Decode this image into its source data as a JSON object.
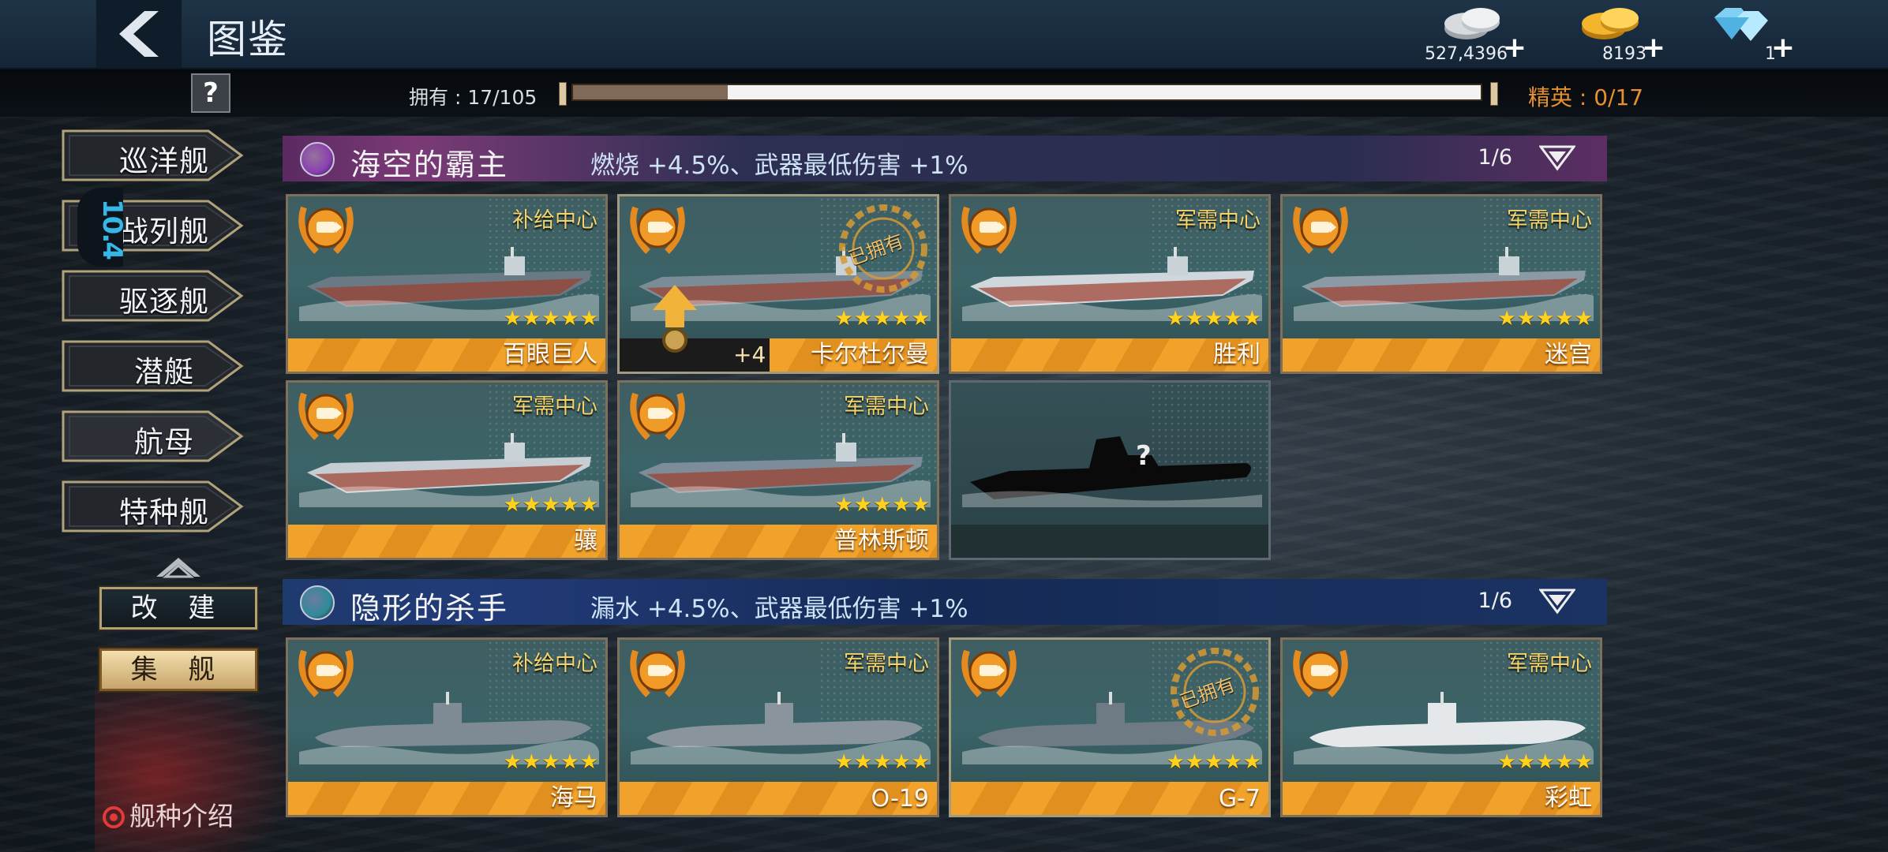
{
  "header": {
    "title": "图鉴",
    "help_label": "?",
    "currencies": [
      {
        "icon": "silver-coins-icon",
        "value": "527,4396",
        "plus": "+"
      },
      {
        "icon": "gold-coins-icon",
        "value": "8193",
        "plus": "+"
      },
      {
        "icon": "diamond-icon",
        "value": "1",
        "plus": "+"
      }
    ],
    "owned_text": "拥有 : 17/105",
    "owned_progress": 0.17,
    "elite_text": "精英 : 0/17"
  },
  "sidebar": {
    "tabs": [
      {
        "label": "巡洋舰",
        "active": false
      },
      {
        "label": "战列舰",
        "active": false
      },
      {
        "label": "驱逐舰",
        "active": false
      },
      {
        "label": "潜艇",
        "active": false
      },
      {
        "label": "航母",
        "active": true
      },
      {
        "label": "特种舰",
        "active": false
      }
    ],
    "badge_text": "10.4",
    "rebuild_label": "改 建",
    "fleet_label": "集 舰",
    "intro_label": "舰种介绍"
  },
  "sections": [
    {
      "title": "海空的霸主",
      "bonus": "燃烧 +4.5%、武器最低伤害 +1%",
      "page": "1/6",
      "emblem_color": "#8a3fb0",
      "cards": [
        {
          "name": "百眼巨人",
          "source": "补给中心",
          "stars": "★★★★★",
          "owned": false
        },
        {
          "name": "卡尔杜尔曼",
          "source": "",
          "stars": "★★★★★",
          "owned": true,
          "stamp": "已拥有",
          "upgrade": "+4"
        },
        {
          "name": "胜利",
          "source": "军需中心",
          "stars": "★★★★★",
          "owned": false
        },
        {
          "name": "迷宫",
          "source": "军需中心",
          "stars": "★★★★★",
          "owned": false
        },
        {
          "name": "骧",
          "source": "军需中心",
          "stars": "★★★★★",
          "owned": false
        },
        {
          "name": "普林斯顿",
          "source": "军需中心",
          "stars": "★★★★★",
          "owned": false
        },
        {
          "name": "",
          "source": "",
          "stars": "",
          "owned": false,
          "locked": true,
          "mystery": "?"
        }
      ]
    },
    {
      "title": "隐形的杀手",
      "bonus": "漏水 +4.5%、武器最低伤害 +1%",
      "page": "1/6",
      "emblem_color": "#2f8a9a",
      "cards": [
        {
          "name": "海马",
          "source": "补给中心",
          "stars": "★★★★★",
          "owned": false
        },
        {
          "name": "O-19",
          "source": "军需中心",
          "stars": "★★★★★",
          "owned": false
        },
        {
          "name": "G-7",
          "source": "",
          "stars": "★★★★★",
          "owned": true,
          "stamp": "已拥有"
        },
        {
          "name": "彩虹",
          "source": "军需中心",
          "stars": "★★★★★",
          "owned": false
        }
      ]
    }
  ],
  "colors": {
    "accent_orange": "#e6902e",
    "star_gold": "#ffd21e",
    "source_gold": "#f3d36b"
  }
}
